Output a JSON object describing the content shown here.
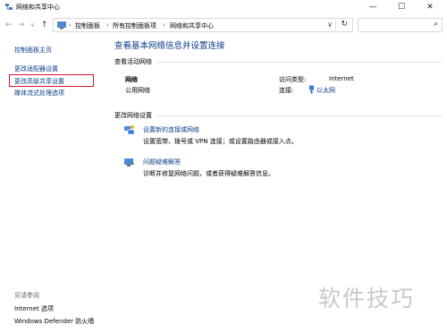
{
  "window": {
    "title": "网络和共享中心",
    "minimize": "—",
    "maximize": "☐",
    "close": "✕"
  },
  "nav": {
    "back": "←",
    "forward": "→",
    "recent": "∨",
    "up": "↑",
    "breadcrumbs": [
      "控制面板",
      "所有控制面板项",
      "网络和共享中心"
    ],
    "separator": "›",
    "dropdown": "∨",
    "refresh": "↻",
    "search_icon": "⌕"
  },
  "sidebar": {
    "items": [
      {
        "label": "控制面板主页"
      },
      {
        "label": "更改适配器设置"
      },
      {
        "label": "更改高级共享设置"
      },
      {
        "label": "媒体流式处理选项"
      }
    ],
    "see_also_header": "另请参阅",
    "see_also": [
      {
        "label": "Internet 选项"
      },
      {
        "label": "Windows Defender 防火墙"
      }
    ]
  },
  "main": {
    "heading": "查看基本网络信息并设置连接",
    "active_header": "查看活动网络",
    "network": {
      "name": "网络",
      "type": "公用网络",
      "access_label": "访问类型:",
      "access_value": "Internet",
      "conn_label": "连接:",
      "conn_value": "以太网"
    },
    "change_header": "更改网络设置",
    "tasks": [
      {
        "title": "设置新的连接或网络",
        "desc": "设置宽带、拨号或 VPN 连接；或设置路由器或接入点。",
        "icon": "network-setup-icon"
      },
      {
        "title": "问题疑难解答",
        "desc": "诊断并修复网络问题，或者获得疑难解答信息。",
        "icon": "troubleshoot-icon"
      }
    ]
  },
  "watermark": "软件技巧",
  "colors": {
    "link": "#0b3c87",
    "highlight": "#d5172a"
  }
}
